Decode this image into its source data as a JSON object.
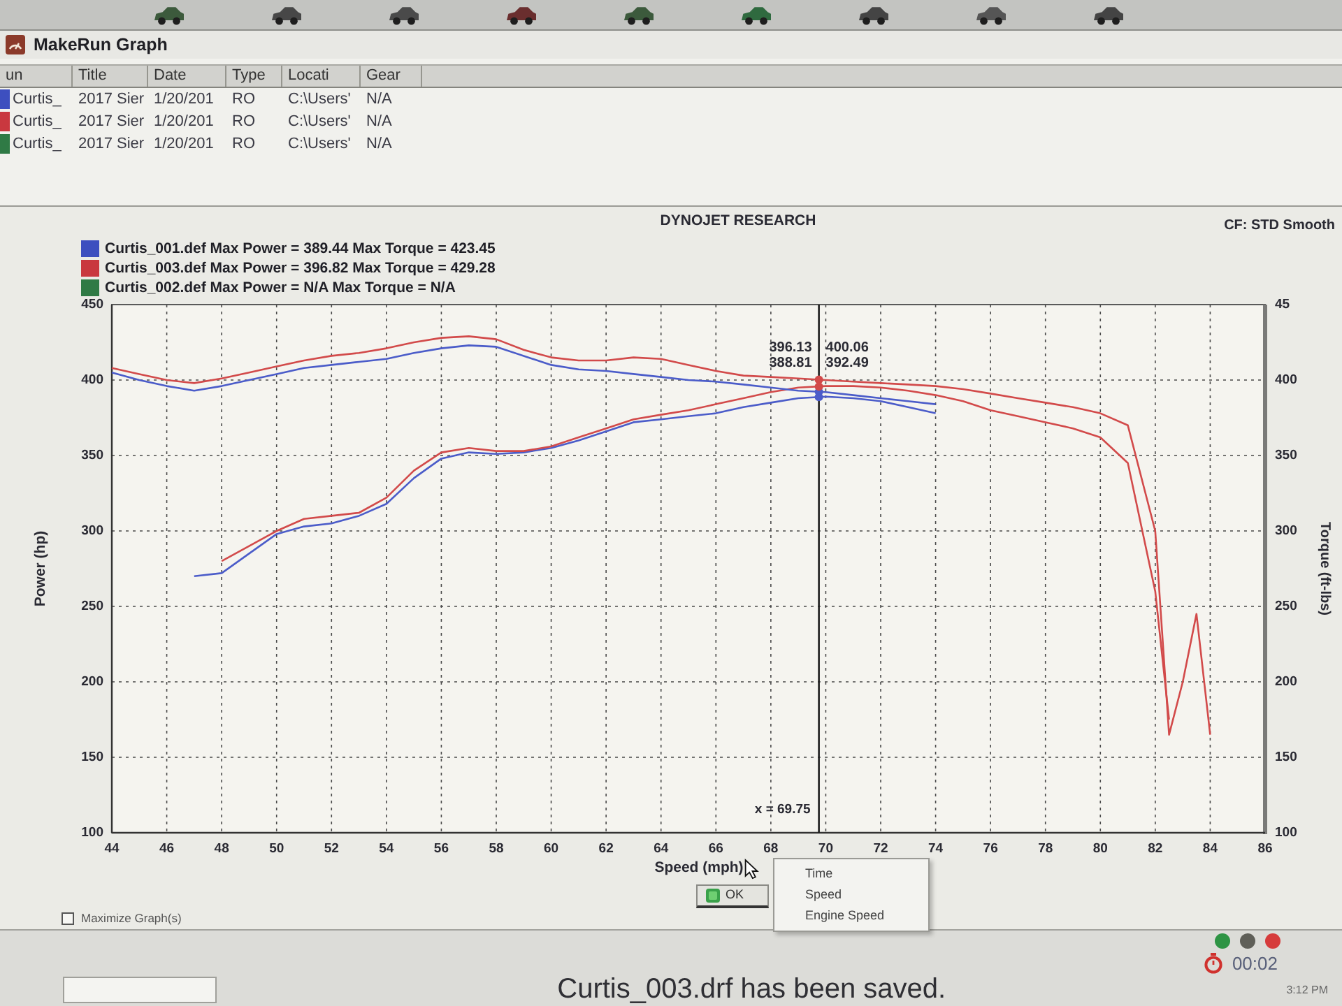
{
  "window": {
    "title": "MakeRun Graph"
  },
  "runs_table": {
    "columns": [
      "un",
      "Title",
      "Date",
      "Type",
      "Locati",
      "Gear"
    ],
    "rows": [
      {
        "color": "#3d4fbf",
        "cells": [
          "Curtis_",
          "2017 Sier",
          "1/20/201",
          "RO",
          "C:\\Users'",
          "N/A"
        ]
      },
      {
        "color": "#c9383f",
        "cells": [
          "Curtis_",
          "2017 Sier",
          "1/20/201",
          "RO",
          "C:\\Users'",
          "N/A"
        ]
      },
      {
        "color": "#2f7a45",
        "cells": [
          "Curtis_",
          "2017 Sier",
          "1/20/201",
          "RO",
          "C:\\Users'",
          "N/A"
        ]
      }
    ]
  },
  "chart": {
    "correction_factor": "CF: STD Smooth",
    "legend": [
      {
        "text": "Curtis_001.def Max Power = 389.44 Max Torque = 423.45",
        "color": "#3d4fbf"
      },
      {
        "text": "Curtis_003.def Max Power = 396.82 Max Torque = 429.28",
        "color": "#c9383f"
      },
      {
        "text": "Curtis_002.def Max Power = N/A Max Torque = N/A",
        "color": "#2f7a45"
      }
    ],
    "right_axis": {
      "label": "Torque (ft-lbs)",
      "ticks": [
        "45",
        "400",
        "350",
        "300",
        "250",
        "200",
        "150",
        "100"
      ]
    },
    "chart_data": {
      "type": "line",
      "title": "DYNOJET RESEARCH",
      "xlabel": "Speed (mph)",
      "ylabel": "Power (hp)",
      "x": [
        44,
        45,
        46,
        47,
        48,
        49,
        50,
        51,
        52,
        53,
        54,
        55,
        56,
        57,
        58,
        59,
        60,
        61,
        62,
        63,
        64,
        65,
        66,
        67,
        68,
        69,
        70,
        71,
        72,
        73,
        74,
        75,
        76,
        77,
        78,
        79,
        80,
        81,
        82,
        82.5,
        83,
        83.5,
        84
      ],
      "series": [
        {
          "color": "#4b5cc9",
          "values": [
            null,
            null,
            null,
            270,
            272,
            285,
            298,
            303,
            305,
            310,
            318,
            335,
            348,
            352,
            351,
            352,
            355,
            360,
            366,
            372,
            374,
            376,
            378,
            382,
            385,
            388,
            389,
            388,
            386,
            382,
            378,
            null,
            null,
            null,
            null,
            null,
            null,
            null,
            null,
            null,
            null,
            null,
            null
          ]
        },
        {
          "color": "#d24a4a",
          "values": [
            null,
            null,
            null,
            null,
            280,
            290,
            300,
            308,
            310,
            312,
            322,
            340,
            352,
            355,
            353,
            353,
            356,
            362,
            368,
            374,
            377,
            380,
            384,
            388,
            392,
            395,
            396,
            396,
            395,
            393,
            390,
            386,
            380,
            376,
            372,
            368,
            362,
            345,
            260,
            175,
            null,
            null,
            null
          ]
        },
        {
          "color": "#4b5cc9",
          "values": [
            405,
            400,
            396,
            393,
            396,
            400,
            404,
            408,
            410,
            412,
            414,
            418,
            421,
            423,
            422,
            416,
            410,
            407,
            406,
            404,
            402,
            400,
            399,
            397,
            395,
            393,
            392,
            390,
            388,
            386,
            384,
            null,
            null,
            null,
            null,
            null,
            null,
            null,
            null,
            null,
            null,
            null,
            null
          ]
        },
        {
          "color": "#d24a4a",
          "values": [
            408,
            404,
            400,
            398,
            401,
            405,
            409,
            413,
            416,
            418,
            421,
            425,
            428,
            429,
            427,
            420,
            415,
            413,
            413,
            415,
            414,
            410,
            406,
            403,
            402,
            401,
            400,
            399,
            398,
            397,
            396,
            394,
            391,
            388,
            385,
            382,
            378,
            370,
            300,
            165,
            200,
            245,
            165
          ]
        }
      ],
      "xlim": [
        44,
        86
      ],
      "ylim": [
        100,
        450
      ],
      "xticks": [
        44,
        46,
        48,
        50,
        52,
        54,
        56,
        58,
        60,
        62,
        64,
        66,
        68,
        70,
        72,
        74,
        76,
        78,
        80,
        82,
        84,
        86
      ],
      "yticks": [
        100,
        150,
        200,
        250,
        300,
        350,
        400,
        450
      ],
      "grid": true,
      "ref_lines": [
        {
          "axis": "x",
          "value": 69.75,
          "label": "x = 69.75"
        }
      ],
      "annotations": [
        "388.81",
        "396.13",
        "392.49",
        "400.06"
      ]
    }
  },
  "axis_menu": {
    "items": [
      "Time",
      "Speed",
      "Engine Speed"
    ]
  },
  "ok_button": {
    "label": "OK"
  },
  "maximize_graphs": {
    "label": "Maximize Graph(s)",
    "checked": false
  },
  "status_lights": [
    {
      "color": "#2e9444"
    },
    {
      "color": "#5f5f58"
    },
    {
      "color": "#d63b3b"
    }
  ],
  "status_bar": {
    "message": "Curtis_003.drf has been saved.",
    "timer": "00:02",
    "clock": "3:12 PM"
  }
}
